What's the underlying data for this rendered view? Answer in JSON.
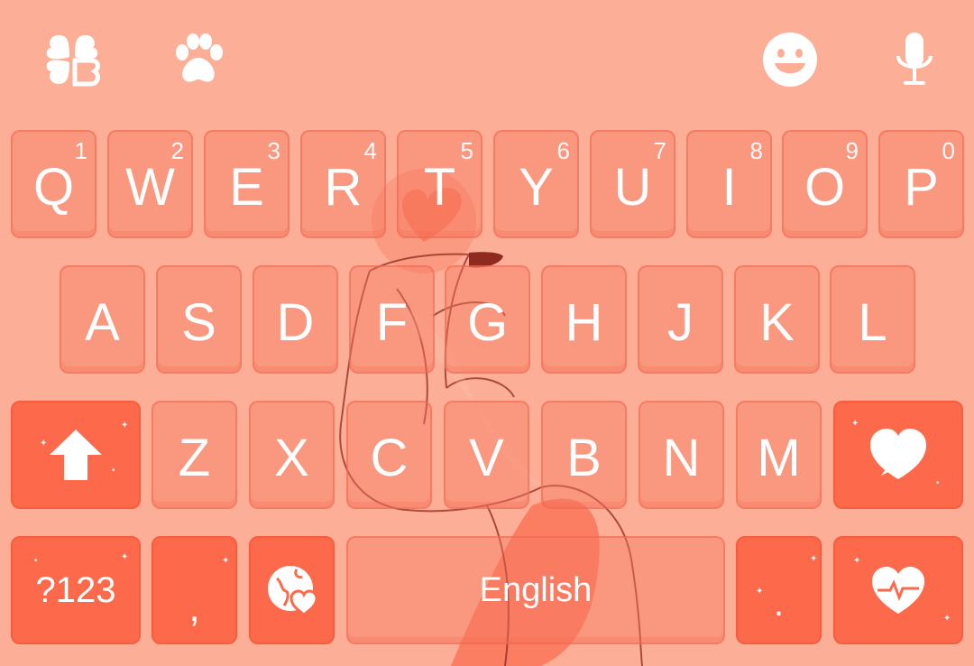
{
  "toolbar": {
    "left": [
      {
        "name": "clover-theme-icon"
      },
      {
        "name": "paw-sticker-icon"
      }
    ],
    "right": [
      {
        "name": "emoji-smiley-icon"
      },
      {
        "name": "microphone-icon"
      }
    ]
  },
  "rows": {
    "row1": [
      {
        "char": "Q",
        "hint": "1"
      },
      {
        "char": "W",
        "hint": "2"
      },
      {
        "char": "E",
        "hint": "3"
      },
      {
        "char": "R",
        "hint": "4"
      },
      {
        "char": "T",
        "hint": "5"
      },
      {
        "char": "Y",
        "hint": "6"
      },
      {
        "char": "U",
        "hint": "7"
      },
      {
        "char": "I",
        "hint": "8"
      },
      {
        "char": "O",
        "hint": "9"
      },
      {
        "char": "P",
        "hint": "0"
      }
    ],
    "row2": [
      "A",
      "S",
      "D",
      "F",
      "G",
      "H",
      "J",
      "K",
      "L"
    ],
    "row3": [
      "Z",
      "X",
      "C",
      "V",
      "B",
      "N",
      "M"
    ]
  },
  "bottom": {
    "symbols_label": "?123",
    "comma_label": ",",
    "space_label": "English",
    "period_label": "."
  },
  "colors": {
    "background": "#fdae96",
    "key_fill": "#f67860",
    "special_key": "#fd6a4b",
    "text": "#ffffff"
  }
}
